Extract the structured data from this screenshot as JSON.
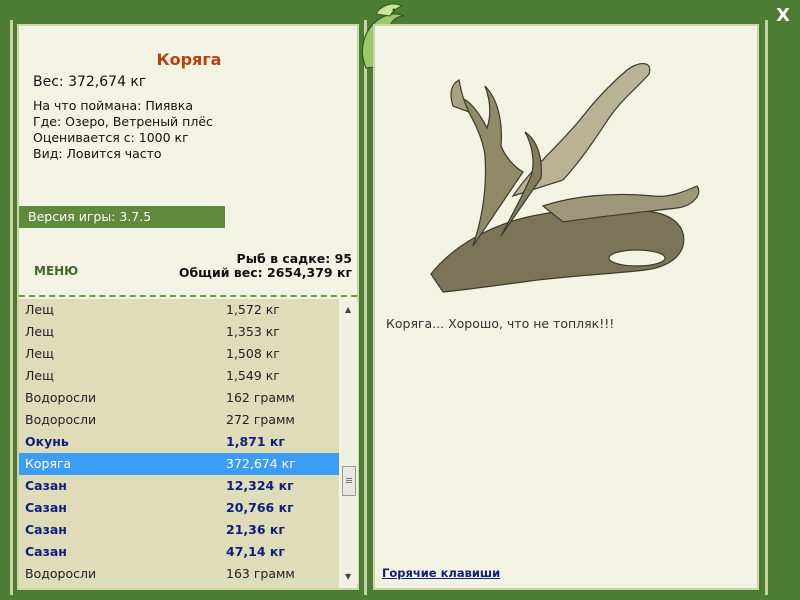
{
  "header": {
    "close_label": "X"
  },
  "fish": {
    "title": "Коряга",
    "weight": "Вес: 372,674 кг",
    "bait": "На что поймана: Пиявка",
    "location": "Где: Озеро, Ветреный плёс",
    "valued": "Оценивается с: 1000 кг",
    "frequency": "Вид: Ловится часто",
    "description": "Коряга... Хорошо, что не топляк!!!"
  },
  "version": "Версия игры: 3.7.5",
  "menu_label": "МЕНЮ",
  "stats": {
    "fish_count": "Рыб в садке: 95",
    "total_weight": "Общий вес: 2654,379 кг"
  },
  "catch_list": [
    {
      "name": "Лещ",
      "weight": "1,572 кг"
    },
    {
      "name": "Лещ",
      "weight": "1,353 кг"
    },
    {
      "name": "Лещ",
      "weight": "1,508 кг"
    },
    {
      "name": "Лещ",
      "weight": "1,549 кг"
    },
    {
      "name": "Водоросли",
      "weight": "162 грамм"
    },
    {
      "name": "Водоросли",
      "weight": "272 грамм"
    },
    {
      "name": "Окунь",
      "weight": "1,871 кг"
    },
    {
      "name": "Коряга",
      "weight": "372,674 кг"
    },
    {
      "name": "Сазан",
      "weight": "12,324 кг"
    },
    {
      "name": "Сазан",
      "weight": "20,766 кг"
    },
    {
      "name": "Сазан",
      "weight": "21,36 кг"
    },
    {
      "name": "Сазан",
      "weight": "47,14 кг"
    },
    {
      "name": "Водоросли",
      "weight": "163 грамм"
    }
  ],
  "hotkeys_label": "Горячие клавиши",
  "icons": {
    "close": "close-icon",
    "logo": "dragon-logo-icon",
    "scroll_up": "scroll-up-icon",
    "scroll_down": "scroll-down-icon"
  },
  "colors": {
    "frame": "#4d7d34",
    "panel": "#f3f3e3",
    "title": "#b8400d",
    "selected": "#3d9cf3",
    "bold_rows": "#10207a"
  }
}
